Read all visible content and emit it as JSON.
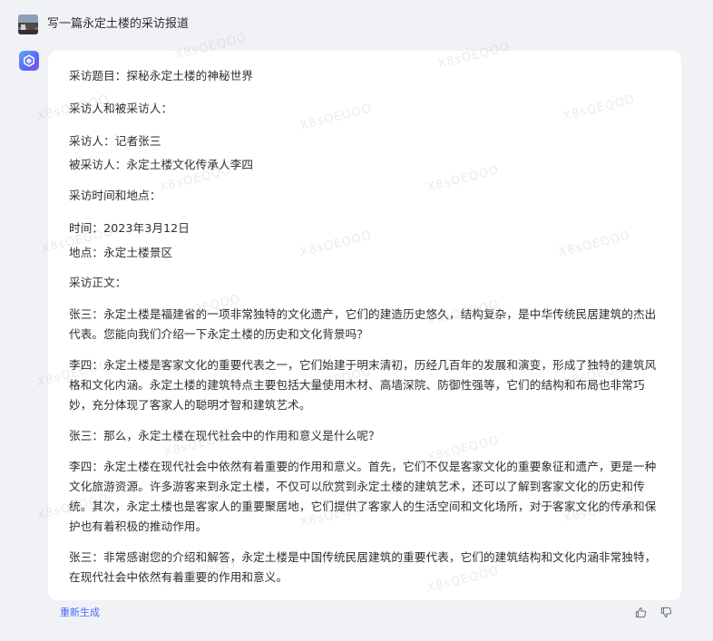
{
  "prompt": {
    "text": "写一篇永定土楼的采访报道"
  },
  "answer": {
    "paragraphs": [
      "采访题目：探秘永定土楼的神秘世界",
      "采访人和被采访人：",
      "采访人：记者张三",
      "被采访人：永定土楼文化传承人李四",
      "采访时间和地点：",
      "时间：2023年3月12日",
      "地点：永定土楼景区",
      "采访正文：",
      "张三：永定土楼是福建省的一项非常独特的文化遗产，它们的建造历史悠久，结构复杂，是中华传统民居建筑的杰出代表。您能向我们介绍一下永定土楼的历史和文化背景吗？",
      "李四：永定土楼是客家文化的重要代表之一，它们始建于明末清初，历经几百年的发展和演变，形成了独特的建筑风格和文化内涵。永定土楼的建筑特点主要包括大量使用木材、高墙深院、防御性强等，它们的结构和布局也非常巧妙，充分体现了客家人的聪明才智和建筑艺术。",
      "张三：那么，永定土楼在现代社会中的作用和意义是什么呢？",
      "李四：永定土楼在现代社会中依然有着重要的作用和意义。首先，它们不仅是客家文化的重要象征和遗产，更是一种文化旅游资源。许多游客来到永定土楼，不仅可以欣赏到永定土楼的建筑艺术，还可以了解到客家文化的历史和传统。其次，永定土楼也是客家人的重要聚居地，它们提供了客家人的生活空间和文化场所，对于客家文化的传承和保护也有着积极的推动作用。",
      "张三：非常感谢您的介绍和解答，永定土楼是中国传统民居建筑的重要代表，它们的建筑结构和文化内涵非常独特，在现代社会中依然有着重要的作用和意义。"
    ]
  },
  "footer": {
    "regenerate_label": "重新生成"
  },
  "watermark": {
    "text": "X8sQEQOO"
  },
  "colors": {
    "background": "#f1f2f6",
    "card": "#ffffff",
    "link": "#4a6cf7"
  },
  "icons": {
    "user_avatar": "user-avatar-photo",
    "bot_avatar": "bot-logo-icon",
    "thumbs_up": "thumbs-up-icon",
    "thumbs_down": "thumbs-down-icon"
  }
}
